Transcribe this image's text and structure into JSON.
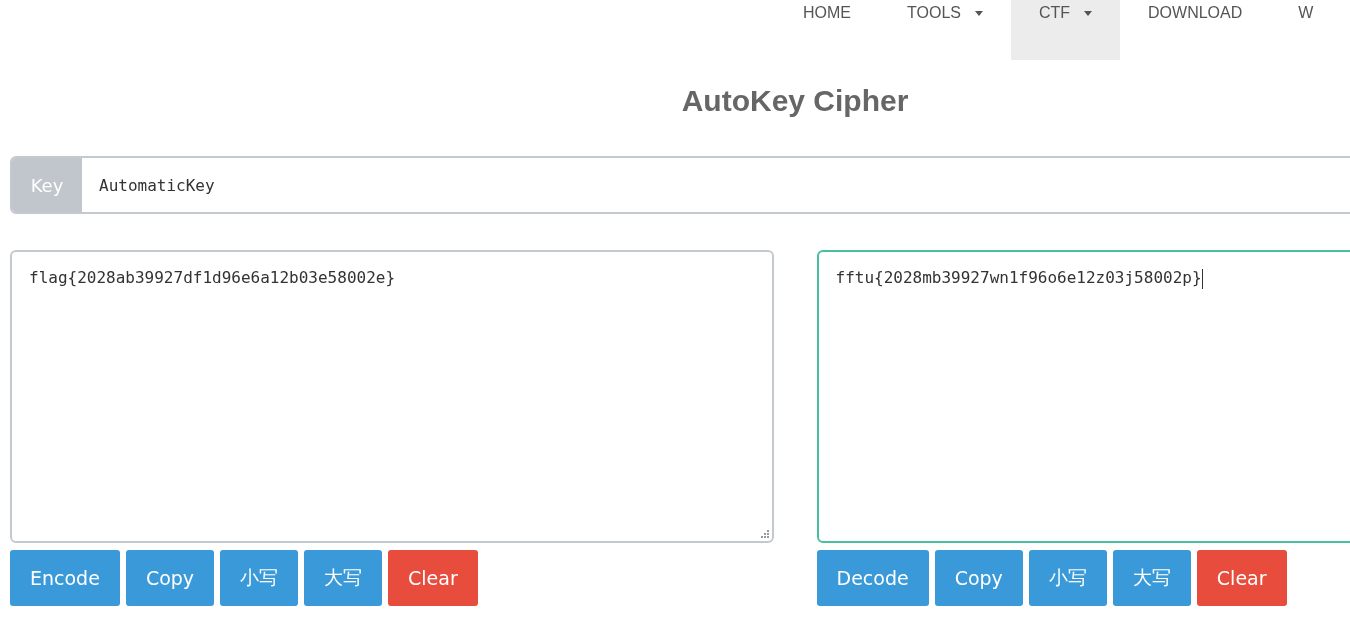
{
  "nav": [
    {
      "label": "HOME",
      "dropdown": false,
      "selected": false
    },
    {
      "label": "TOOLS",
      "dropdown": true,
      "selected": false
    },
    {
      "label": "CTF",
      "dropdown": true,
      "selected": true
    },
    {
      "label": "DOWNLOAD",
      "dropdown": false,
      "selected": false
    },
    {
      "label": "W",
      "dropdown": false,
      "selected": false
    }
  ],
  "title": "AutoKey Cipher",
  "key": {
    "label": "Key",
    "value": "AutomaticKey"
  },
  "panels": [
    {
      "text": "flag{2028ab39927df1d96e6a12b03e58002e}",
      "focused": false,
      "buttons": [
        {
          "label": "Encode",
          "kind": "primary"
        },
        {
          "label": "Copy",
          "kind": "primary"
        },
        {
          "label": "小写",
          "kind": "primary"
        },
        {
          "label": "大写",
          "kind": "primary"
        },
        {
          "label": "Clear",
          "kind": "danger"
        }
      ]
    },
    {
      "text": "fftu{2028mb39927wn1f96o6e12z03j58002p}",
      "focused": true,
      "buttons": [
        {
          "label": "Decode",
          "kind": "primary"
        },
        {
          "label": "Copy",
          "kind": "primary"
        },
        {
          "label": "小写",
          "kind": "primary"
        },
        {
          "label": "大写",
          "kind": "primary"
        },
        {
          "label": "Clear",
          "kind": "danger"
        }
      ]
    }
  ]
}
